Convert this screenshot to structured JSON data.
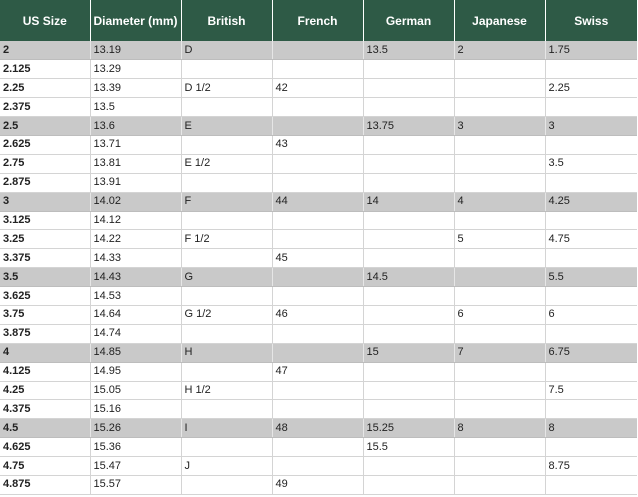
{
  "table": {
    "headers": [
      "US Size",
      "Diameter (mm)",
      "British",
      "French",
      "German",
      "Japanese",
      "Swiss"
    ],
    "rows": [
      {
        "shaded": true,
        "cells": [
          "2",
          "13.19",
          "D",
          "",
          "13.5",
          "2",
          "1.75"
        ]
      },
      {
        "shaded": false,
        "cells": [
          "2.125",
          "13.29",
          "",
          "",
          "",
          "",
          ""
        ]
      },
      {
        "shaded": false,
        "cells": [
          "2.25",
          "13.39",
          "D 1/2",
          "42",
          "",
          "",
          "2.25"
        ]
      },
      {
        "shaded": false,
        "cells": [
          "2.375",
          "13.5",
          "",
          "",
          "",
          "",
          ""
        ]
      },
      {
        "shaded": true,
        "cells": [
          "2.5",
          "13.6",
          "E",
          "",
          "13.75",
          "3",
          "3"
        ]
      },
      {
        "shaded": false,
        "cells": [
          "2.625",
          "13.71",
          "",
          "43",
          "",
          "",
          ""
        ]
      },
      {
        "shaded": false,
        "cells": [
          "2.75",
          "13.81",
          "E 1/2",
          "",
          "",
          "",
          "3.5"
        ]
      },
      {
        "shaded": false,
        "cells": [
          "2.875",
          "13.91",
          "",
          "",
          "",
          "",
          ""
        ]
      },
      {
        "shaded": true,
        "cells": [
          "3",
          "14.02",
          "F",
          "44",
          "14",
          "4",
          "4.25"
        ]
      },
      {
        "shaded": false,
        "cells": [
          "3.125",
          "14.12",
          "",
          "",
          "",
          "",
          ""
        ]
      },
      {
        "shaded": false,
        "cells": [
          "3.25",
          "14.22",
          "F 1/2",
          "",
          "",
          "5",
          "4.75"
        ]
      },
      {
        "shaded": false,
        "cells": [
          "3.375",
          "14.33",
          "",
          "45",
          "",
          "",
          ""
        ]
      },
      {
        "shaded": true,
        "cells": [
          "3.5",
          "14.43",
          "G",
          "",
          "14.5",
          "",
          "5.5"
        ]
      },
      {
        "shaded": false,
        "cells": [
          "3.625",
          "14.53",
          "",
          "",
          "",
          "",
          ""
        ]
      },
      {
        "shaded": false,
        "cells": [
          "3.75",
          "14.64",
          "G 1/2",
          "46",
          "",
          "6",
          "6"
        ]
      },
      {
        "shaded": false,
        "cells": [
          "3.875",
          "14.74",
          "",
          "",
          "",
          "",
          ""
        ]
      },
      {
        "shaded": true,
        "cells": [
          "4",
          "14.85",
          "H",
          "",
          "15",
          "7",
          "6.75"
        ]
      },
      {
        "shaded": false,
        "cells": [
          "4.125",
          "14.95",
          "",
          "47",
          "",
          "",
          ""
        ]
      },
      {
        "shaded": false,
        "cells": [
          "4.25",
          "15.05",
          "H 1/2",
          "",
          "",
          "",
          "7.5"
        ]
      },
      {
        "shaded": false,
        "cells": [
          "4.375",
          "15.16",
          "",
          "",
          "",
          "",
          ""
        ]
      },
      {
        "shaded": true,
        "cells": [
          "4.5",
          "15.26",
          "I",
          "48",
          "15.25",
          "8",
          "8"
        ]
      },
      {
        "shaded": false,
        "cells": [
          "4.625",
          "15.36",
          "",
          "",
          "15.5",
          "",
          ""
        ]
      },
      {
        "shaded": false,
        "cells": [
          "4.75",
          "15.47",
          "J",
          "",
          "",
          "",
          "8.75"
        ]
      },
      {
        "shaded": false,
        "cells": [
          "4.875",
          "15.57",
          "",
          "49",
          "",
          "",
          ""
        ]
      }
    ]
  },
  "colors": {
    "header_background": "#2e5a46",
    "header_text": "#ffffff",
    "shaded_row": "#c9c9c9"
  }
}
